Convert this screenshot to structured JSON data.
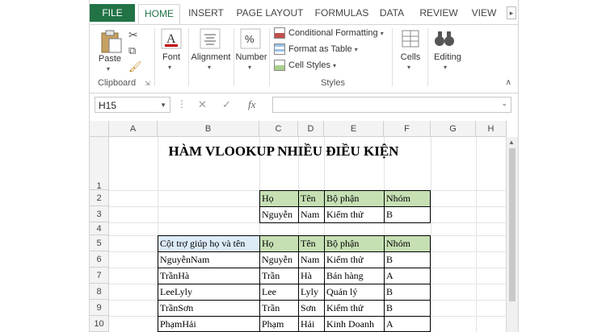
{
  "ribbon": {
    "tabs": [
      "FILE",
      "HOME",
      "INSERT",
      "PAGE LAYOUT",
      "FORMULAS",
      "DATA",
      "REVIEW",
      "VIEW"
    ],
    "paste_label": "Paste",
    "clipboard_label": "Clipboard",
    "font_label": "Font",
    "alignment_label": "Alignment",
    "number_label": "Number",
    "conditional_formatting": "Conditional Formatting",
    "format_as_table": "Format as Table",
    "cell_styles": "Cell Styles",
    "styles_label": "Styles",
    "cells_label": "Cells",
    "editing_label": "Editing"
  },
  "formula_bar": {
    "name_box": "H15",
    "fx": "fx",
    "value": ""
  },
  "sheet": {
    "columns": [
      "A",
      "B",
      "C",
      "D",
      "E",
      "F",
      "G",
      "H"
    ],
    "rows": [
      "1",
      "2",
      "3",
      "4",
      "5",
      "6",
      "7",
      "8",
      "9",
      "10"
    ],
    "title": "HÀM VLOOKUP NHIỀU ĐIỀU KIỆN",
    "lookup_header": [
      "Họ",
      "Tên",
      "Bộ phận",
      "Nhóm"
    ],
    "lookup_row": [
      "Nguyễn",
      "Nam",
      "Kiểm thử",
      "B"
    ],
    "table_header": [
      "Cột trợ giúp họ và tên",
      "Họ",
      "Tên",
      "Bộ phận",
      "Nhóm"
    ],
    "table_rows": [
      [
        "NguyễnNam",
        "Nguyễn",
        "Nam",
        "Kiểm thử",
        "B"
      ],
      [
        "TrầnHà",
        "Trần",
        "Hà",
        "Bán hàng",
        "A"
      ],
      [
        "LeeLyly",
        "Lee",
        "Lyly",
        "Quản lý",
        "B"
      ],
      [
        "TrầnSơn",
        "Trần",
        "Sơn",
        "Kiểm thử",
        "B"
      ],
      [
        "PhạmHải",
        "Phạm",
        "Hải",
        "Kinh Doanh",
        "A"
      ]
    ]
  }
}
